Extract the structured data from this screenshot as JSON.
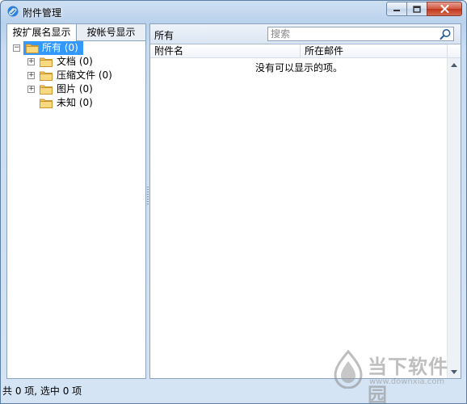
{
  "window": {
    "title": "附件管理"
  },
  "tabs": [
    {
      "label": "按扩展名显示",
      "active": true
    },
    {
      "label": "按帐号显示",
      "active": false
    }
  ],
  "tree": [
    {
      "label": "所有 (0)",
      "level": 0,
      "expander": "−",
      "selected": true
    },
    {
      "label": "文档 (0)",
      "level": 1,
      "expander": "+"
    },
    {
      "label": "压缩文件 (0)",
      "level": 1,
      "expander": "+"
    },
    {
      "label": "图片 (0)",
      "level": 1,
      "expander": "+"
    },
    {
      "label": "未知 (0)",
      "level": 1,
      "expander": ""
    }
  ],
  "right": {
    "header": "所有",
    "search": {
      "placeholder": "搜索",
      "value": ""
    },
    "columns": [
      "附件名",
      "所在邮件",
      ""
    ],
    "empty_message": "没有可以显示的项。"
  },
  "status": {
    "text": "共 0 项, 选中 0 项"
  },
  "watermark": {
    "title": "当下软件园",
    "url": "www.downxia.com"
  },
  "colors": {
    "selection": "#3399ff",
    "frame": "#b9d1ec",
    "folder": "#f2c460"
  },
  "icons": {
    "app": "paperclip-icon",
    "minimize": "minimize-icon",
    "maximize": "maximize-icon",
    "close": "close-icon",
    "folder": "folder-icon",
    "search": "search-icon"
  }
}
